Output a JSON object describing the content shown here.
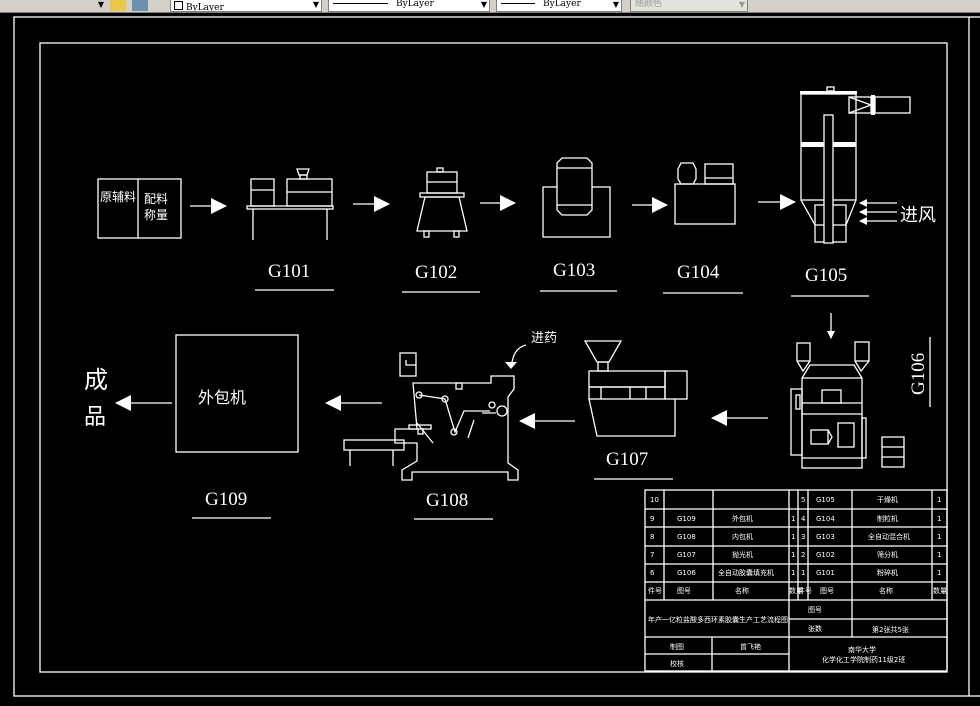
{
  "toolbar": {
    "layer_value": "ByLayer",
    "linetype_value": "ByLayer",
    "lineweight_value": "ByLayer",
    "plotstyle_value": "随颜色"
  },
  "drawing": {
    "raw_box": {
      "left": "原辅料",
      "right_line1": "配料",
      "right_line2": "称量"
    },
    "labels": [
      "G101",
      "G102",
      "G103",
      "G104",
      "G105",
      "G106",
      "G107",
      "G108",
      "G109"
    ],
    "air_inlet": "进风",
    "drug_inlet": "进药",
    "outer_pack_machine": "外包机",
    "product_line1": "成",
    "product_line2": "品"
  },
  "title_block": {
    "rows": [
      {
        "no": "10",
        "code": "",
        "name": "",
        "qty": "",
        "no2": "5",
        "code2": "G105",
        "name2": "干燥机",
        "qty2": "1"
      },
      {
        "no": "9",
        "code": "G109",
        "name": "外包机",
        "qty": "1",
        "no2": "4",
        "code2": "G104",
        "name2": "制粒机",
        "qty2": "1"
      },
      {
        "no": "8",
        "code": "G108",
        "name": "内包机",
        "qty": "1",
        "no2": "3",
        "code2": "G103",
        "name2": "全自动混合机",
        "qty2": "1"
      },
      {
        "no": "7",
        "code": "G107",
        "name": "抛光机",
        "qty": "1",
        "no2": "2",
        "code2": "G102",
        "name2": "筛分机",
        "qty2": "1"
      },
      {
        "no": "6",
        "code": "G106",
        "name": "全自动胶囊填充机",
        "qty": "1",
        "no2": "1",
        "code2": "G101",
        "name2": "粉碎机",
        "qty2": "1"
      }
    ],
    "header": {
      "no": "件号",
      "code": "图号",
      "name": "名称",
      "qty": "数量"
    },
    "drawing_title": "年产一亿粒盐酸多西环素胶囊生产工艺流程图",
    "drawing_no_label": "图号",
    "drawing_no_value": "",
    "sheets_label": "张数",
    "sheets_value": "第2张共5张",
    "drawn_by_label": "制图",
    "drawn_by_value": "曾飞艳",
    "checked_by_label": "校核",
    "checked_by_value": "",
    "school_line1": "南华大学",
    "school_line2": "化学化工学院制药11级2班"
  }
}
